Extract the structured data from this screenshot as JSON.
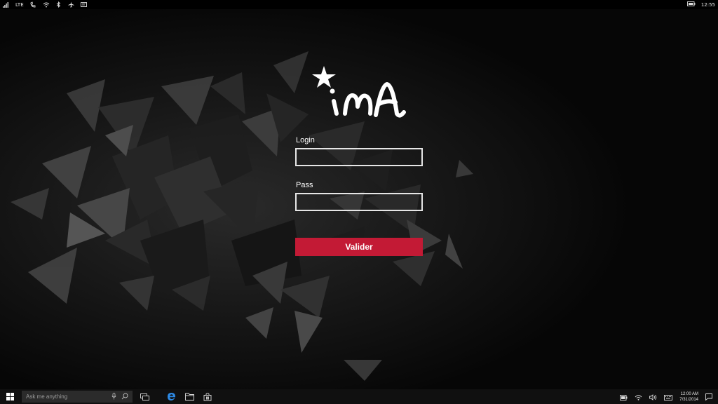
{
  "status_bar": {
    "network_type": "LTE",
    "time": "12:55",
    "icons": [
      "signal-icon",
      "lte-label",
      "wifi-calling-icon",
      "wifi-icon",
      "bluetooth-icon",
      "airplane-icon",
      "message-icon",
      "battery-icon"
    ]
  },
  "app": {
    "logo_text": "iMA",
    "login_label": "Login",
    "login_value": "",
    "pass_label": "Pass",
    "pass_value": "",
    "submit_label": "Valider",
    "accent_color": "#c31a35"
  },
  "taskbar": {
    "search_placeholder": "Ask me anything",
    "clock_time": "12:00 AM",
    "clock_date": "7/31/2014",
    "pinned": [
      "task-view-icon",
      "edge-icon",
      "file-explorer-icon",
      "store-icon"
    ],
    "tray": [
      "battery-icon",
      "wifi-icon",
      "volume-icon",
      "keyboard-icon",
      "notification-icon"
    ]
  }
}
